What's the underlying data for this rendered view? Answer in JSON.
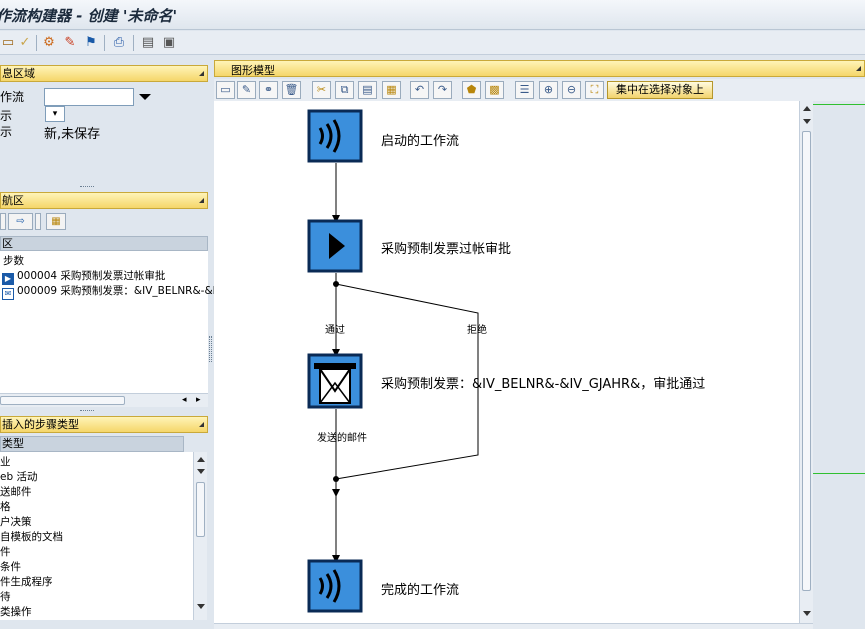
{
  "window": {
    "title": "作流构建器 - 创建 '未命名'"
  },
  "left": {
    "info_header": "息区域",
    "info_fields": [
      {
        "label": "作流"
      },
      {
        "label": "示"
      },
      {
        "label": "示",
        "value": "新,未保存"
      }
    ],
    "nav_header": "航区",
    "tree_header": "区",
    "tree_rows": [
      {
        "text": "步数"
      },
      {
        "text": "000004 采购预制发票过帐审批"
      },
      {
        "text": "000009 采购预制发票：&IV_BELNR&-&IV"
      }
    ],
    "steps_header": "插入的步骤类型",
    "steps_col_header": "类型",
    "steps": [
      "业",
      "eb 活动",
      "送邮件",
      "格",
      "户决策",
      "自模板的文档",
      "件",
      "条件",
      "件生成程序",
      "待",
      "类操作"
    ]
  },
  "graph": {
    "header": "图形模型",
    "center_button": "集中在选择对象上",
    "nodes": [
      {
        "label": "启动的工作流",
        "icon": "sound-wave-icon"
      },
      {
        "label": "采购预制发票过帐审批",
        "icon": "play-icon"
      },
      {
        "label": "采购预制发票：&IV_BELNR&-&IV_GJAHR&，审批通过",
        "icon": "mail-icon"
      },
      {
        "label": "完成的工作流",
        "icon": "sound-wave-icon"
      }
    ],
    "edge_labels": {
      "approve": "通过",
      "reject": "拒绝",
      "sent": "发送的邮件"
    }
  },
  "colors": {
    "node_blue": "#3b8fdc",
    "header_yellow": "#f5d66a",
    "overview_line": "#30c030"
  }
}
